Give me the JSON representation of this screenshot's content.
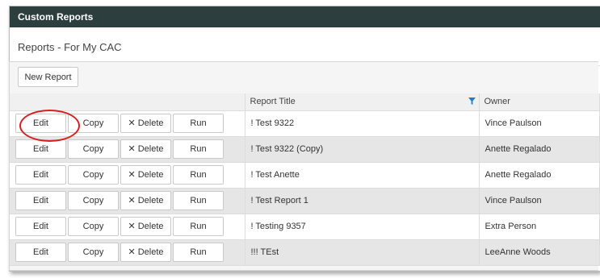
{
  "window": {
    "title": "Custom Reports"
  },
  "page": {
    "heading": "Reports - For My CAC"
  },
  "toolbar": {
    "new_report_label": "New Report"
  },
  "table": {
    "columns": {
      "actions": "",
      "title": "Report Title",
      "owner": "Owner"
    },
    "action_labels": {
      "edit": "Edit",
      "copy": "Copy",
      "delete": "Delete",
      "run": "Run"
    },
    "rows": [
      {
        "title": "! Test 9322",
        "owner": "Vince Paulson"
      },
      {
        "title": "! Test 9322 (Copy)",
        "owner": "Anette Regalado"
      },
      {
        "title": "! Test Anette",
        "owner": "Anette Regalado"
      },
      {
        "title": "! Test Report 1",
        "owner": "Vince Paulson"
      },
      {
        "title": "! Testing 9357",
        "owner": "Extra Person"
      },
      {
        "title": "!!! TEst",
        "owner": "LeeAnne Woods"
      }
    ]
  },
  "icons": {
    "filter": "filter-icon",
    "delete": "x-icon"
  },
  "colors": {
    "titlebar": "#2d3e3e",
    "filter": "#2a7bbf",
    "highlight": "#d81f1f"
  }
}
